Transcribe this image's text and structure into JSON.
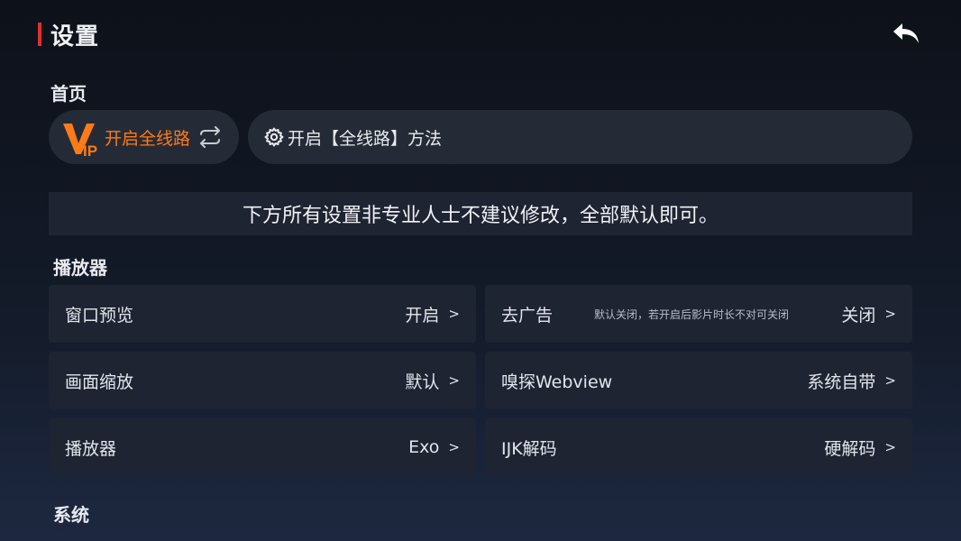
{
  "header": {
    "title": "设置",
    "back_icon": "back-arrow-icon"
  },
  "home": {
    "section_label": "首页",
    "vip_button": {
      "icon": "vip-logo-icon",
      "label": "开启全线路",
      "swap_icon": "swap-icon"
    },
    "method_button": {
      "icon": "gear-icon",
      "label": "开启【全线路】方法"
    }
  },
  "notice": {
    "text": "下方所有设置非专业人士不建议修改，全部默认即可。"
  },
  "player": {
    "section_label": "播放器",
    "items": [
      {
        "label": "窗口预览",
        "hint": "",
        "value": "开启",
        "arrow": ">"
      },
      {
        "label": "去广告",
        "hint": "默认关闭，若开启后影片时长不对可关闭",
        "value": "关闭",
        "arrow": ">"
      },
      {
        "label": "画面缩放",
        "hint": "",
        "value": "默认",
        "arrow": ">"
      },
      {
        "label": "嗅探Webview",
        "hint": "",
        "value": "系统自带",
        "arrow": ">"
      },
      {
        "label": "播放器",
        "hint": "",
        "value": "Exo",
        "arrow": ">"
      },
      {
        "label": "IJK解码",
        "hint": "",
        "value": "硬解码",
        "arrow": ">"
      }
    ]
  },
  "system": {
    "section_label": "系统"
  },
  "colors": {
    "accent_red": "#e0302c",
    "vip_orange": "#ff7a18",
    "card_bg": "#1e2431",
    "pill_bg": "#252b36"
  }
}
